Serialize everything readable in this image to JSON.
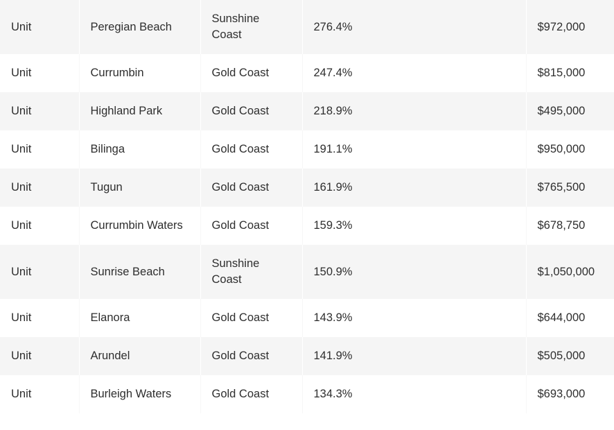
{
  "table": {
    "columns": [
      {
        "key": "property_type",
        "align": "left"
      },
      {
        "key": "suburb",
        "align": "left"
      },
      {
        "key": "region",
        "align": "left"
      },
      {
        "key": "growth",
        "align": "left"
      },
      {
        "key": "median_price",
        "align": "left"
      }
    ],
    "rows": [
      {
        "property_type": "Unit",
        "suburb": "Peregian Beach",
        "region": "Sunshine Coast",
        "growth": "276.4%",
        "median_price": "$972,000"
      },
      {
        "property_type": "Unit",
        "suburb": "Currumbin",
        "region": "Gold Coast",
        "growth": "247.4%",
        "median_price": "$815,000"
      },
      {
        "property_type": "Unit",
        "suburb": "Highland Park",
        "region": "Gold Coast",
        "growth": "218.9%",
        "median_price": "$495,000"
      },
      {
        "property_type": "Unit",
        "suburb": "Bilinga",
        "region": "Gold Coast",
        "growth": "191.1%",
        "median_price": "$950,000"
      },
      {
        "property_type": "Unit",
        "suburb": "Tugun",
        "region": "Gold Coast",
        "growth": "161.9%",
        "median_price": "$765,500"
      },
      {
        "property_type": "Unit",
        "suburb": "Currumbin Waters",
        "region": "Gold Coast",
        "growth": "159.3%",
        "median_price": "$678,750"
      },
      {
        "property_type": "Unit",
        "suburb": "Sunrise Beach",
        "region": "Sunshine Coast",
        "growth": "150.9%",
        "median_price": "$1,050,000"
      },
      {
        "property_type": "Unit",
        "suburb": "Elanora",
        "region": "Gold Coast",
        "growth": "143.9%",
        "median_price": "$644,000"
      },
      {
        "property_type": "Unit",
        "suburb": "Arundel",
        "region": "Gold Coast",
        "growth": "141.9%",
        "median_price": "$505,000"
      },
      {
        "property_type": "Unit",
        "suburb": "Burleigh Waters",
        "region": "Gold Coast",
        "growth": "134.3%",
        "median_price": "$693,000"
      }
    ]
  },
  "colors": {
    "row_shaded_bg": "#f5f5f5",
    "row_plain_bg": "#ffffff",
    "text": "#2e2e2e"
  }
}
